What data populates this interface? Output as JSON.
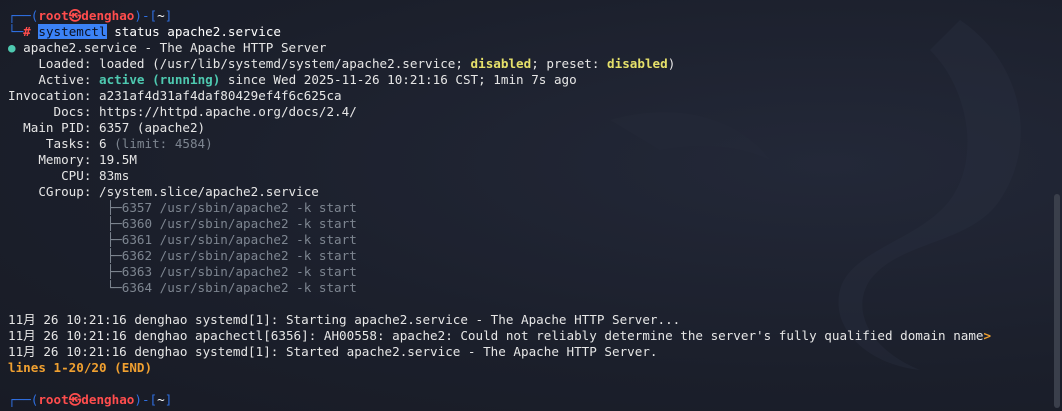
{
  "prompt": {
    "bracket_open": "┌──(",
    "user": "root",
    "at": "㉿",
    "host": "denghao",
    "close": ")-[",
    "dir": "~",
    "end": "]",
    "hash_prefix": "└─",
    "hash": "#"
  },
  "command": {
    "selected": "systemctl",
    "rest": " status apache2.service"
  },
  "status": {
    "dot": "●",
    "header": " apache2.service - The Apache HTTP Server",
    "loaded_key": "    Loaded: ",
    "loaded_a": "loaded (/usr/lib/systemd/system/apache2.service; ",
    "loaded_disabled": "disabled",
    "loaded_b": "; preset: ",
    "loaded_preset": "disabled",
    "loaded_c": ")",
    "active_key": "    Active: ",
    "active_val": "active (running)",
    "active_rest": " since Wed 2025-11-26 10:21:16 CST; 1min 7s ago",
    "invocation": "Invocation: a231af4d31af4daf80429ef4f6c625ca",
    "docs": "      Docs: https://httpd.apache.org/docs/2.4/",
    "mainpid": "  Main PID: 6357 (apache2)",
    "tasks_key": "     Tasks: 6 ",
    "tasks_limit": "(limit: 4584)",
    "memory": "    Memory: 19.5M",
    "cpu": "       CPU: 83ms",
    "cgroup": "    CGroup: /system.slice/apache2.service",
    "processes": [
      "             ├─6357 /usr/sbin/apache2 -k start",
      "             ├─6360 /usr/sbin/apache2 -k start",
      "             ├─6361 /usr/sbin/apache2 -k start",
      "             ├─6362 /usr/sbin/apache2 -k start",
      "             ├─6363 /usr/sbin/apache2 -k start",
      "             └─6364 /usr/sbin/apache2 -k start"
    ]
  },
  "logs": [
    "11月 26 10:21:16 denghao systemd[1]: Starting apache2.service - The Apache HTTP Server...",
    "11月 26 10:21:16 denghao apachectl[6356]: AH00558: apache2: Could not reliably determine the server's fully qualified domain name",
    "11月 26 10:21:16 denghao systemd[1]: Started apache2.service - The Apache HTTP Server."
  ],
  "log_overflow": ">",
  "pager": "lines 1-20/20 (END)",
  "colors": {
    "background": "#1b1f2b",
    "prompt_blue": "#2f6fe0",
    "prompt_red": "#ff4d4d",
    "active_green": "#4ec9b0",
    "disabled_yellow": "#e5e06a",
    "pager_orange": "#f0a030"
  }
}
